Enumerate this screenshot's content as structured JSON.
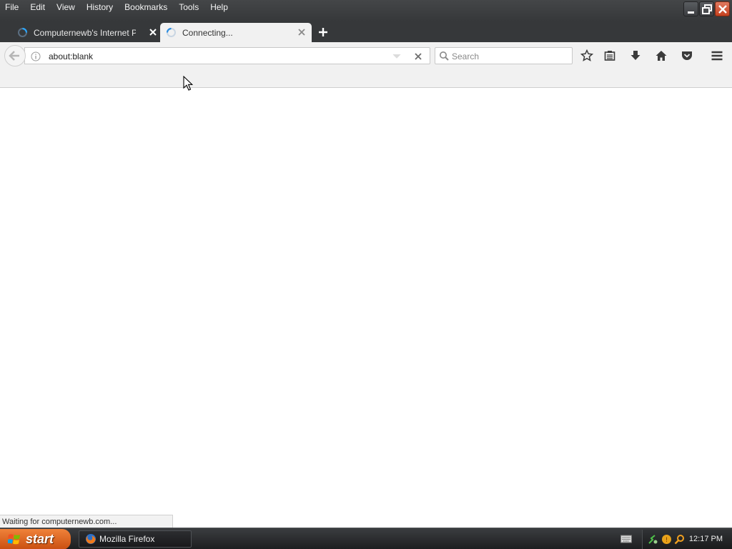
{
  "menubar": {
    "items": [
      "File",
      "Edit",
      "View",
      "History",
      "Bookmarks",
      "Tools",
      "Help"
    ]
  },
  "window_controls": {
    "icons": [
      "minimize-icon",
      "restore-icon",
      "close-icon"
    ]
  },
  "tabs": [
    {
      "title": "Computernewb's Internet Pu...",
      "state": "loading",
      "active": false
    },
    {
      "title": "Connecting...",
      "state": "loading",
      "active": true
    }
  ],
  "navbar": {
    "url": "about:blank",
    "search_placeholder": "Search",
    "toolbar_icons": [
      "star-icon",
      "reading-list-icon",
      "download-icon",
      "home-icon",
      "pocket-icon",
      "hamburger-menu-icon"
    ]
  },
  "status": {
    "text": "Waiting for computernewb.com..."
  },
  "taskbar": {
    "start_label": "start",
    "tasks": [
      {
        "label": "Mozilla Firefox"
      }
    ],
    "clock": "12:17 PM"
  },
  "colors": {
    "chrome_dark": "#36383a",
    "toolbar": "#f1f1f1",
    "start_orange": "#e0702a",
    "close_red": "#c4401e"
  }
}
